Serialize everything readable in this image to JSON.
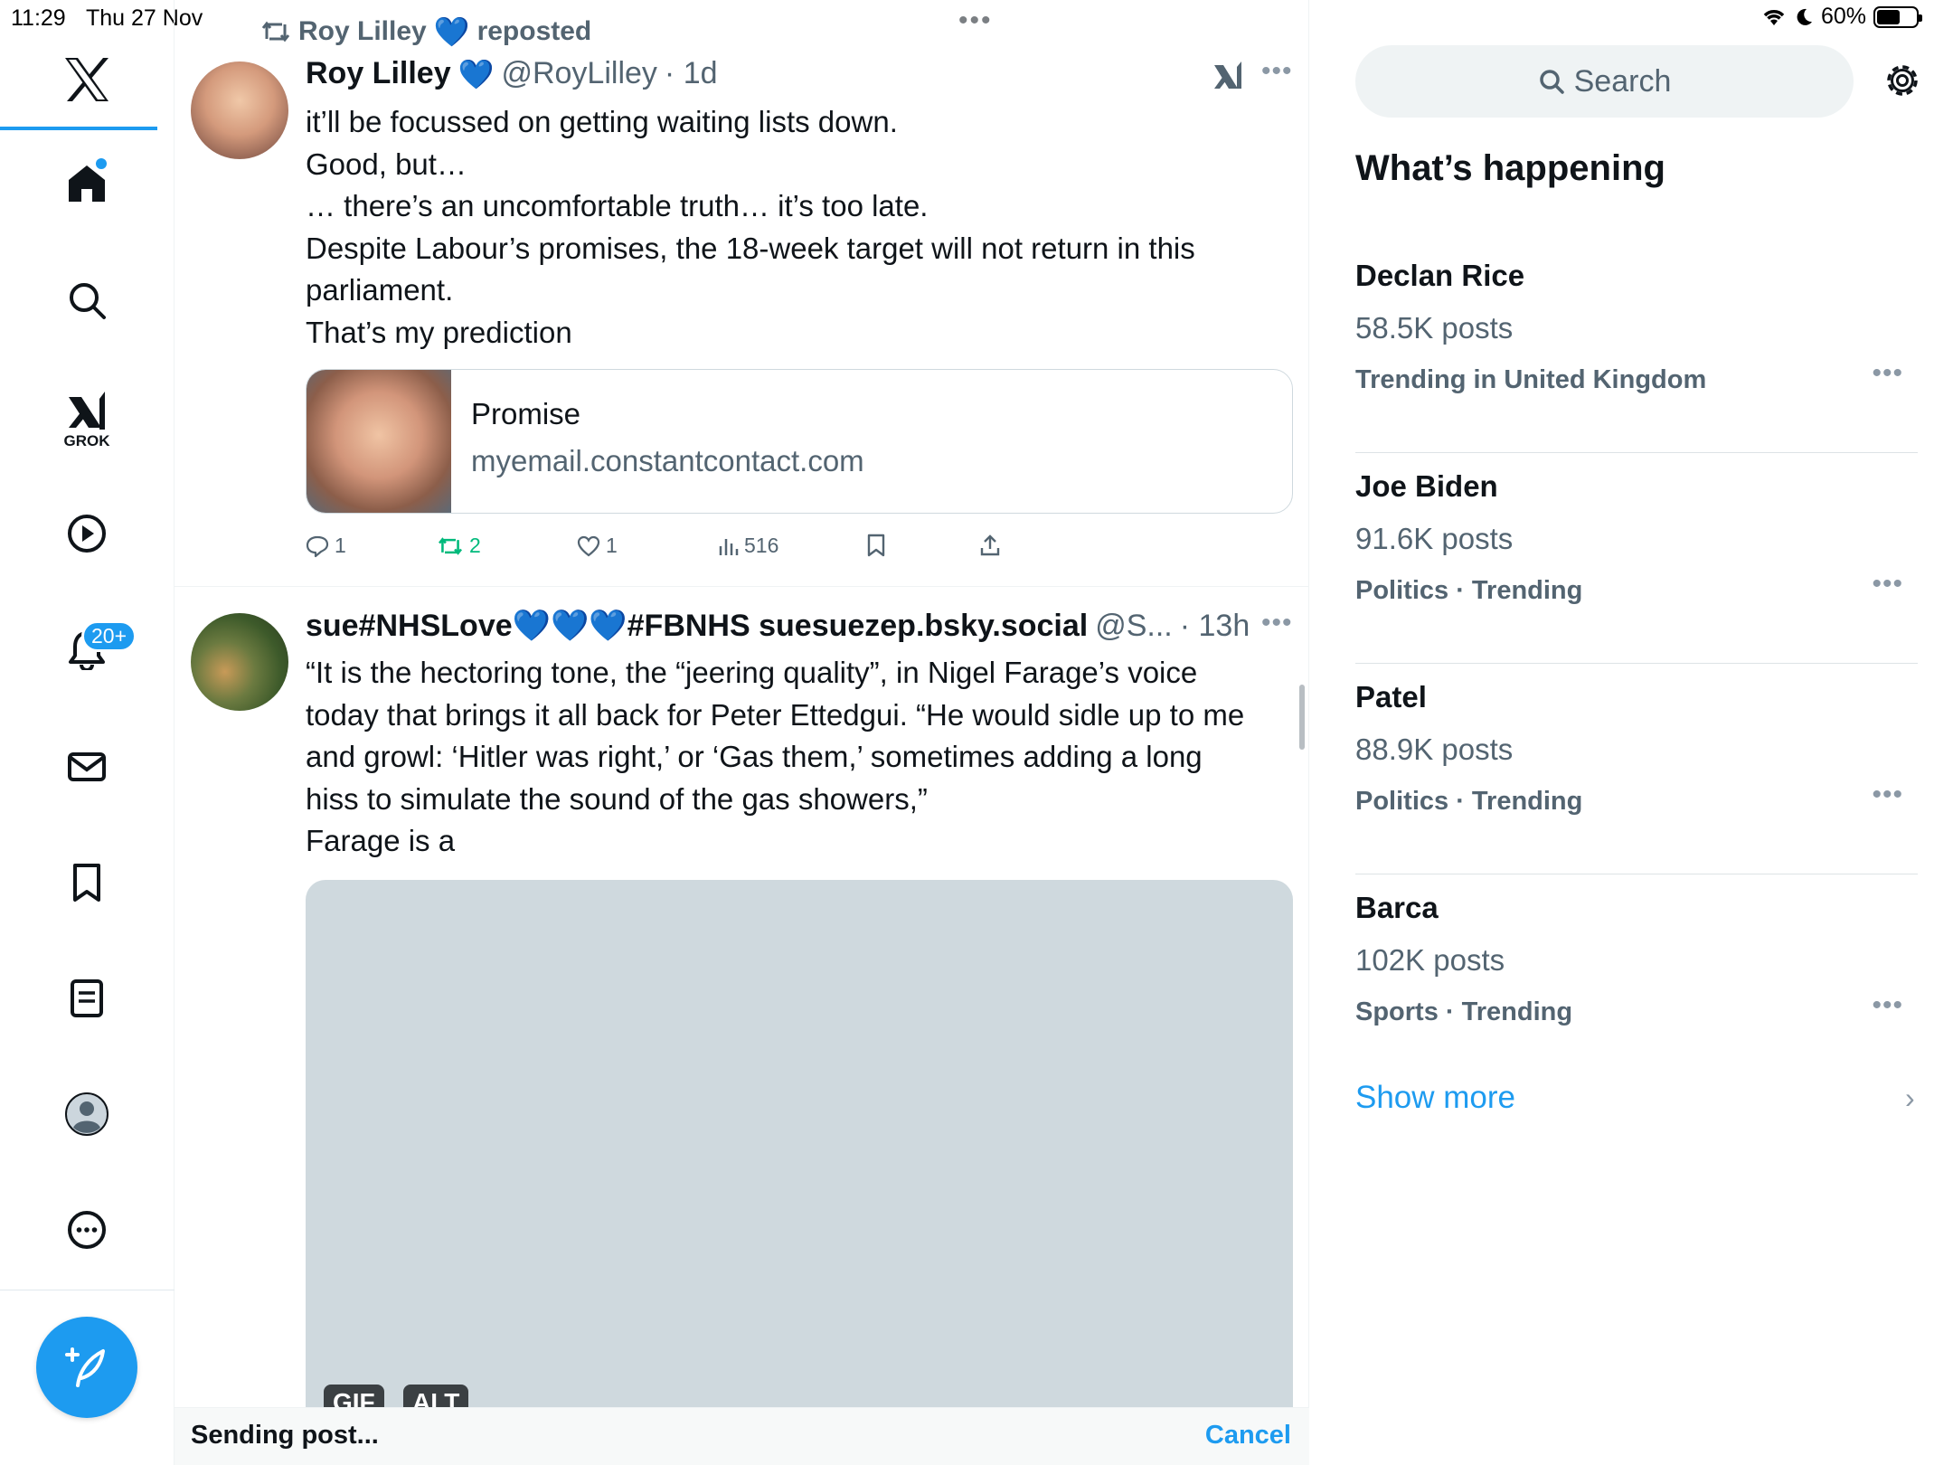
{
  "status_bar": {
    "time": "11:29",
    "date": "Thu 27 Nov",
    "battery": "60%",
    "battery_level": 0.6
  },
  "nav": {
    "grok_label": "GROK",
    "notifications_badge": "20+"
  },
  "tweets": [
    {
      "repost_by": "Roy Lilley",
      "repost_label": "reposted",
      "name": "Roy Lilley",
      "handle": "@RoyLilley",
      "time": "· 1d",
      "lines": [
        "it’ll be focussed on getting waiting lists down.",
        "Good, but…",
        "… there’s an uncomfortable truth… it’s too late.",
        "Despite Labour’s promises, the 18-week target will not return in this",
        "parliament.",
        "That’s my prediction"
      ],
      "card": {
        "title": "Promise",
        "domain": "myemail.constantcontact.com"
      },
      "stats": {
        "replies": "1",
        "reposts": "2",
        "likes": "1",
        "views": "516"
      }
    },
    {
      "name": "sue#NHSLove💙💙💙#FBNHS suesuezep.bsky.social",
      "handle": "@S...",
      "time": "· 13h",
      "lines": [
        "“It is the hectoring tone, the “jeering quality”, in Nigel Farage’s voice",
        "today that brings it all back for Peter Ettedgui. “He would sidle up to me",
        "and growl: ‘Hitler was right,’ or ‘Gas them,’ sometimes adding a long",
        "hiss to simulate the sound of the gas showers,”",
        "Farage is a"
      ],
      "media_chips": [
        "GIF",
        "ALT"
      ]
    }
  ],
  "sending_bar": {
    "label": "Sending post...",
    "cancel": "Cancel"
  },
  "sidebar": {
    "search_placeholder": "Search",
    "heading": "What’s happening",
    "trends": [
      {
        "name": "Declan Rice",
        "count": "58.5K posts",
        "meta": "Trending in United Kingdom"
      },
      {
        "name": "Joe Biden",
        "count": "91.6K posts",
        "meta": "Politics · Trending"
      },
      {
        "name": "Patel",
        "count": "88.9K posts",
        "meta": "Politics · Trending"
      },
      {
        "name": "Barca",
        "count": "102K posts",
        "meta": "Sports · Trending"
      }
    ],
    "show_more": "Show more"
  }
}
